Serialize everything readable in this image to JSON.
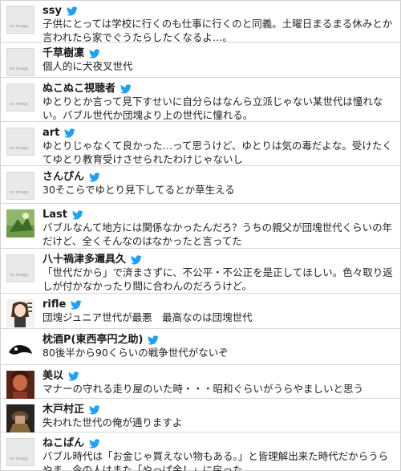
{
  "colors": {
    "twitter_blue": "#1DA1F2",
    "avatar_bg": "#e9e9e9",
    "divider": "#d6d6d6"
  },
  "avatar_placeholder_text": "no image",
  "tweets": [
    {
      "name": "ssy",
      "text": "子供にとっては学校に行くのも仕事に行くのと同義。土曜日まるまる休みとか言われたら家でぐうたらしたくなるよ…。",
      "avatar": "placeholder"
    },
    {
      "name": "千草樹凜",
      "text": "個人的に犬夜叉世代",
      "avatar": "placeholder"
    },
    {
      "name": "ぬこぬこ視聴者",
      "text": "ゆとりとか言って見下すせいに自分らはなんら立派じゃない某世代は憧れない。バブル世代か団塊より上の世代に憧れる。",
      "avatar": "placeholder"
    },
    {
      "name": "art",
      "text": "ゆとりじゃなくて良かった…って思うけど、ゆとりは気の毒だよな。受けたくてゆとり教育受けさせられたわけじゃないし",
      "avatar": "placeholder"
    },
    {
      "name": "さんぴん",
      "text": "30そこらでゆとり見下してるとか草生える",
      "avatar": "placeholder"
    },
    {
      "name": "Last",
      "text": "バブルなんて地方には関係なかったんだろ？うちの親父が団塊世代くらいの年だけど、全くそんなのはなかったと言ってた",
      "avatar": "photo-green"
    },
    {
      "name": "八十禍津多邇具久",
      "text": "「世代だから」で済まさずに、不公平・不公正を是正してほしい。色々取り返しが付かなかったり間に合わんのだろうけど。",
      "avatar": "placeholder"
    },
    {
      "name": "rifle",
      "text": "団塊ジュニア世代が最悪　最高なのは団塊世代",
      "avatar": "photo-character"
    },
    {
      "name": "枕酒P(東西亭円之助)",
      "text": "80後半から90くらいの戦争世代がないぞ",
      "avatar": "photo-bw"
    },
    {
      "name": "美以",
      "text": "マナーの守れる走り屋のいた時・・・昭和ぐらいがうらやましいと思う",
      "avatar": "photo-red"
    },
    {
      "name": "木戸村正",
      "text": "失われた世代の俺が通りますよ",
      "avatar": "photo-armor"
    },
    {
      "name": "ねこぱん",
      "text": "バブル時代は「お金じゃ買えない物もある。」と皆理解出来た時代だからうらやま。今の人はまた「やっぱ金！」に戻った。",
      "avatar": "placeholder"
    }
  ]
}
